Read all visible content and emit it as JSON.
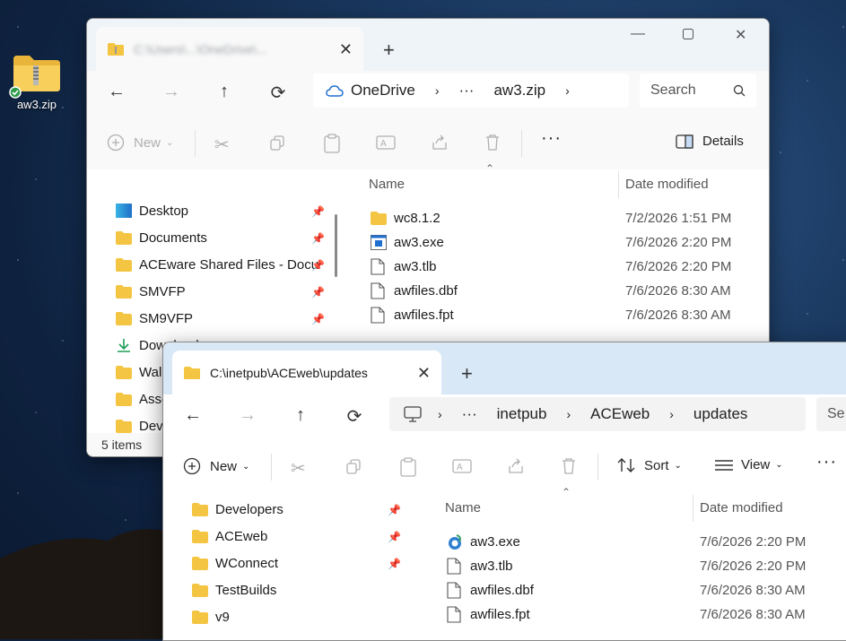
{
  "desktop": {
    "icon_label": "aw3.zip"
  },
  "window1": {
    "tab_title": "C:\\Users\\...\\OneDrive\\...",
    "address": [
      "OneDrive",
      "···",
      "aw3.zip"
    ],
    "search_placeholder": "Search",
    "toolbar": {
      "new_label": "New",
      "details_label": "Details"
    },
    "nav_items": [
      {
        "label": "Desktop"
      },
      {
        "label": "Documents"
      },
      {
        "label": "ACEware Shared Files - Docu"
      },
      {
        "label": "SMVFP"
      },
      {
        "label": "SM9VFP"
      },
      {
        "label": "Downloads"
      },
      {
        "label": "Wallpapers"
      },
      {
        "label": "Assets"
      },
      {
        "label": "Developers"
      }
    ],
    "columns": {
      "name": "Name",
      "date": "Date modified"
    },
    "files": [
      {
        "name": "wc8.1.2",
        "date": "7/2/2026 1:51 PM",
        "icon": "folder-icon"
      },
      {
        "name": "aw3.exe",
        "date": "7/6/2026 2:20 PM",
        "icon": "exe-icon"
      },
      {
        "name": "aw3.tlb",
        "date": "7/6/2026 2:20 PM",
        "icon": "file-icon"
      },
      {
        "name": "awfiles.dbf",
        "date": "7/6/2026 8:30 AM",
        "icon": "file-icon"
      },
      {
        "name": "awfiles.fpt",
        "date": "7/6/2026 8:30 AM",
        "icon": "file-icon"
      }
    ],
    "status": "5 items"
  },
  "window2": {
    "tab_title": "C:\\inetpub\\ACEweb\\updates",
    "address": [
      "···",
      "inetpub",
      "ACEweb",
      "updates"
    ],
    "search_placeholder": "Se",
    "toolbar": {
      "new_label": "New",
      "sort_label": "Sort",
      "view_label": "View"
    },
    "nav_items": [
      {
        "label": "Developers"
      },
      {
        "label": "ACEweb"
      },
      {
        "label": "WConnect"
      },
      {
        "label": "TestBuilds"
      },
      {
        "label": "v9"
      }
    ],
    "columns": {
      "name": "Name",
      "date": "Date modified"
    },
    "files": [
      {
        "name": "aw3.exe",
        "date": "7/6/2026 2:20 PM",
        "icon": "app-icon"
      },
      {
        "name": "aw3.tlb",
        "date": "7/6/2026 2:20 PM",
        "icon": "file-icon"
      },
      {
        "name": "awfiles.dbf",
        "date": "7/6/2026 8:30 AM",
        "icon": "file-icon"
      },
      {
        "name": "awfiles.fpt",
        "date": "7/6/2026 8:30 AM",
        "icon": "file-icon"
      }
    ]
  },
  "colors": {
    "folder": "#f4c542",
    "accent": "#0078d4",
    "check": "#2e9a4b"
  }
}
